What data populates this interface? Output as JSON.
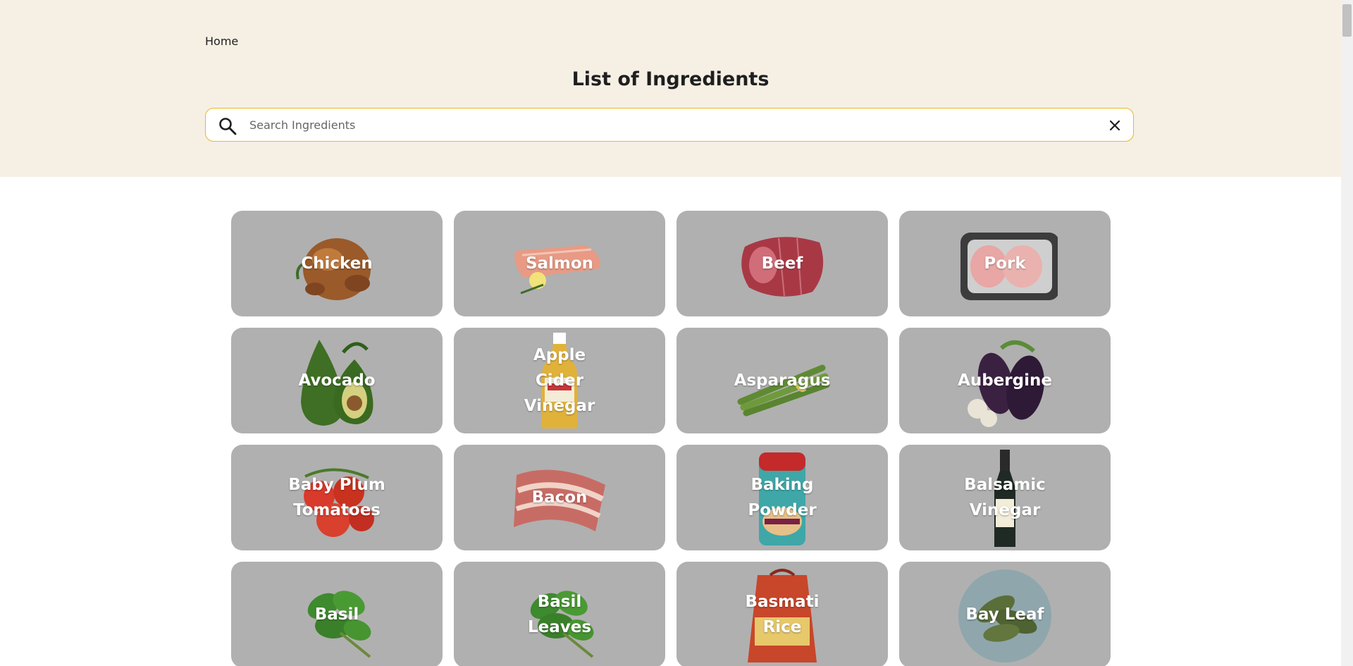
{
  "breadcrumb": {
    "home_label": "Home"
  },
  "header": {
    "title": "List of Ingredients"
  },
  "search": {
    "placeholder": "Search Ingredients",
    "value": ""
  },
  "colors": {
    "hero_bg": "#f6efe4",
    "search_border": "#e8b923",
    "card_bg": "#b0b0b0",
    "card_text": "#ffffff"
  },
  "ingredients": [
    {
      "name": "Chicken",
      "image": "roast-chicken"
    },
    {
      "name": "Salmon",
      "image": "salmon-fillet"
    },
    {
      "name": "Beef",
      "image": "beef-joint"
    },
    {
      "name": "Pork",
      "image": "pork-chops-tray"
    },
    {
      "name": "Avocado",
      "image": "avocado"
    },
    {
      "name": "Apple Cider Vinegar",
      "image": "vinegar-bottle"
    },
    {
      "name": "Asparagus",
      "image": "asparagus-bunch"
    },
    {
      "name": "Aubergine",
      "image": "aubergine"
    },
    {
      "name": "Baby Plum Tomatoes",
      "image": "tomatoes"
    },
    {
      "name": "Bacon",
      "image": "bacon-rashers"
    },
    {
      "name": "Baking Powder",
      "image": "baking-powder-tin"
    },
    {
      "name": "Balsamic Vinegar",
      "image": "balsamic-bottle"
    },
    {
      "name": "Basil",
      "image": "basil-sprig"
    },
    {
      "name": "Basil Leaves",
      "image": "basil-sprig"
    },
    {
      "name": "Basmati Rice",
      "image": "rice-sack"
    },
    {
      "name": "Bay Leaf",
      "image": "bay-leaves-plate"
    }
  ]
}
